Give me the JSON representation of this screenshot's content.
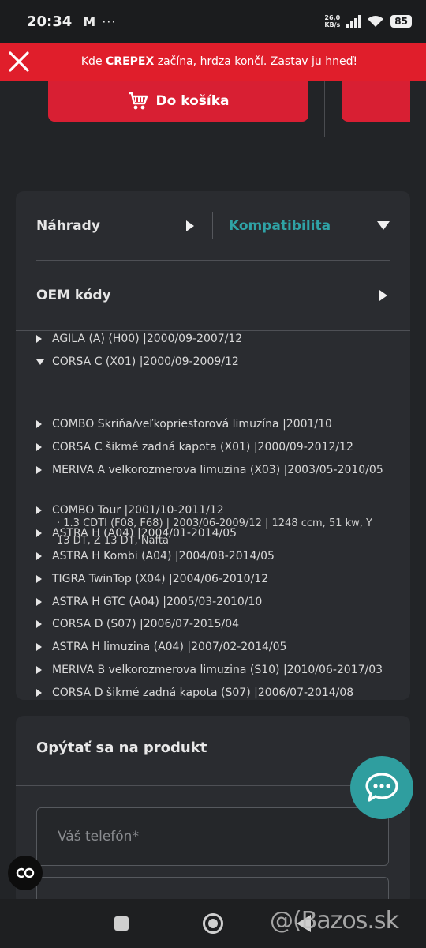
{
  "status_bar": {
    "time": "20:34",
    "mail_icon": "M",
    "more": "···",
    "speed_value": "26,0",
    "speed_unit": "KB/s",
    "battery": "85"
  },
  "promo": {
    "text_before": "Kde ",
    "brand": "CREPEX",
    "text_after": " začína, hrdza končí. Zastav ju hneď!",
    "color": "#e01e2b"
  },
  "product": {
    "cart_button_label": "Do košíka",
    "accent": "#d81f33"
  },
  "tabs": {
    "replacements": "Náhrady",
    "compatibility": "Kompatibilita",
    "compatibility_color": "#2fa3a6",
    "oem_codes": "OEM kódy"
  },
  "vehicles": [
    {
      "label": "AGILA (A) (H00) |2000/09-2007/12",
      "expanded": false
    },
    {
      "label": "CORSA C (X01) |2000/09-2009/12",
      "expanded": true
    },
    {
      "label": "COMBO Skriňa/veľkopriestorová limuzína |2001/10",
      "expanded": false
    },
    {
      "label": "CORSA C šikmé zadná kapota (X01) |2000/09-2012/12",
      "expanded": false
    },
    {
      "label": "MERIVA A velkorozmerova limuzina (X03) |2003/05-2010/05",
      "expanded": false
    },
    {
      "label": "COMBO Tour |2001/10-2011/12",
      "expanded": false
    },
    {
      "label": "ASTRA H (A04) |2004/01-2014/05",
      "expanded": false
    },
    {
      "label": "ASTRA H Kombi (A04) |2004/08-2014/05",
      "expanded": false
    },
    {
      "label": "TIGRA TwinTop (X04) |2004/06-2010/12",
      "expanded": false
    },
    {
      "label": "ASTRA H GTC (A04) |2005/03-2010/10",
      "expanded": false
    },
    {
      "label": "CORSA D (S07) |2006/07-2015/04",
      "expanded": false
    },
    {
      "label": "ASTRA H limuzina (A04) |2007/02-2014/05",
      "expanded": false
    },
    {
      "label": "MERIVA B velkorozmerova limuzina (S10) |2010/06-2017/03",
      "expanded": false
    },
    {
      "label": "CORSA D šikmé zadná kapota (S07) |2006/07-2014/08",
      "expanded": false
    }
  ],
  "engine_detail": "· 1.3 CDTI (F08, F68) | 2003/06-2009/12 | 1248 ccm, 51 kw, Y 13 DT, Z 13 DT, Nafta",
  "ask": {
    "title": "Opýtať sa na produkt",
    "phone_placeholder": "Váš telefón*"
  },
  "fab_color": "#2f9e9f",
  "co_label": "CO",
  "watermark": "@(Bazos.sk"
}
